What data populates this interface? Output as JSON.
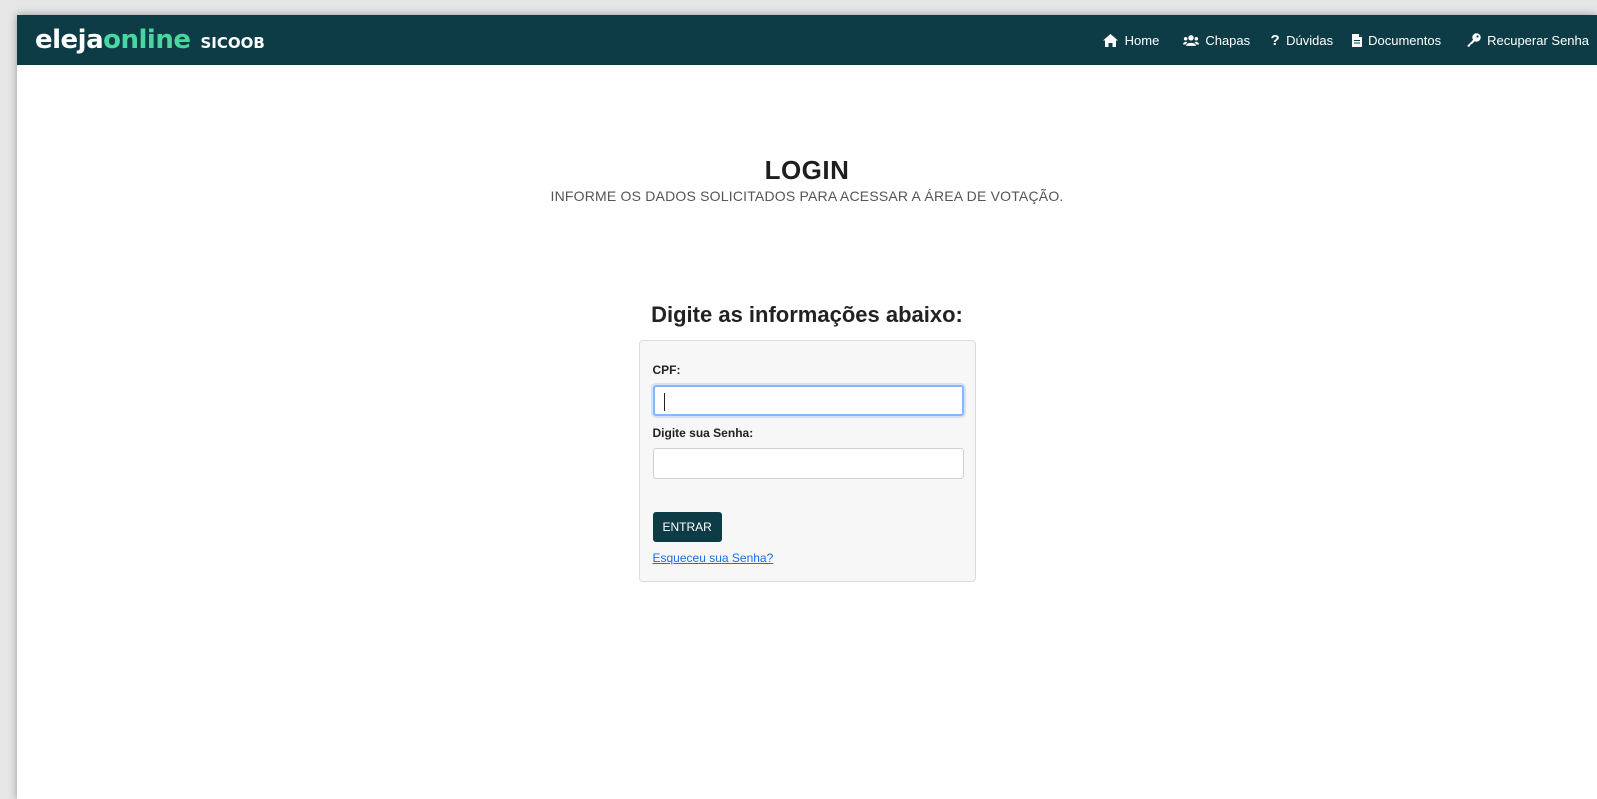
{
  "brand": {
    "name_part1": "eleja",
    "name_part2": "online",
    "org": "SICOOB"
  },
  "nav": {
    "items": [
      {
        "label": "Home",
        "icon": "home-icon"
      },
      {
        "label": "Chapas",
        "icon": "users-icon"
      },
      {
        "label": "Dúvidas",
        "icon": "question-icon"
      },
      {
        "label": "Documentos",
        "icon": "document-icon"
      },
      {
        "label": "Recuperar Senha",
        "icon": "key-icon"
      }
    ]
  },
  "page": {
    "title": "LOGIN",
    "subtitle": "INFORME OS DADOS SOLICITADOS PARA ACESSAR A ÁREA DE VOTAÇÃO.",
    "form_heading": "Digite as informações abaixo:"
  },
  "form": {
    "cpf_label": "CPF:",
    "cpf_value": "",
    "password_label": "Digite sua Senha:",
    "password_value": "",
    "submit_label": "ENTRAR",
    "forgot_label": "Esqueceu sua Senha?"
  },
  "colors": {
    "navbar": "#0d3c46",
    "accent": "#49d6a0",
    "link": "#1a6ee6"
  }
}
